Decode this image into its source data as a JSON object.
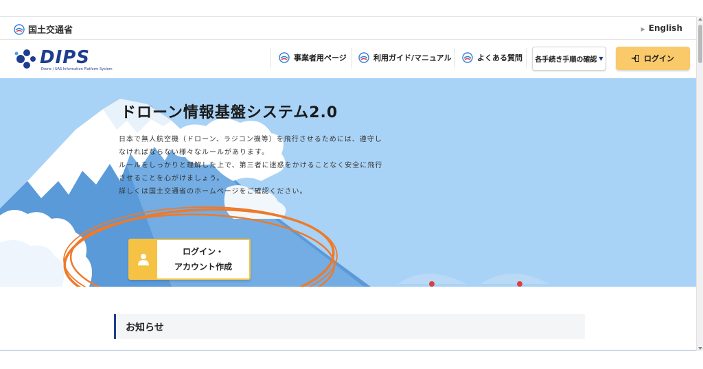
{
  "gov_bar": {
    "ministry_name": "国土交通省",
    "english_link": "English"
  },
  "header": {
    "logo_text": "DIPS",
    "logo_subtitle": "Drone / UAS Information Platform System",
    "nav": [
      {
        "label": "事業者用ページ",
        "icon": "mlit-icon"
      },
      {
        "label": "利用ガイド/マニュアル",
        "icon": "mlit-icon"
      },
      {
        "label": "よくある質問",
        "icon": "mlit-icon"
      }
    ],
    "procedures_dropdown": "各手続き手順の確認",
    "login_button": "ログイン"
  },
  "hero": {
    "title": "ドローン情報基盤システム2.0",
    "description": [
      "日本で無人航空機（ドローン、ラジコン機等）を飛行させるためには、遵守し",
      "なければならない様々なルールがあります。",
      "ルールをしっかりと理解した上で、第三者に迷惑をかけることなく安全に飛行",
      "させることを心がけましょう。",
      "詳しくは国土交通省のホームページをご確認ください。"
    ],
    "cta_line1": "ログイン・",
    "cta_line2": "アカウント作成"
  },
  "news": {
    "heading": "お知らせ"
  },
  "colors": {
    "hero_bg": "#a9d3f6",
    "brand_navy": "#1d3d8f",
    "accent_yellow": "#f6c244",
    "login_yellow": "#f9c96a",
    "annotation_orange": "#ee7a2a"
  }
}
